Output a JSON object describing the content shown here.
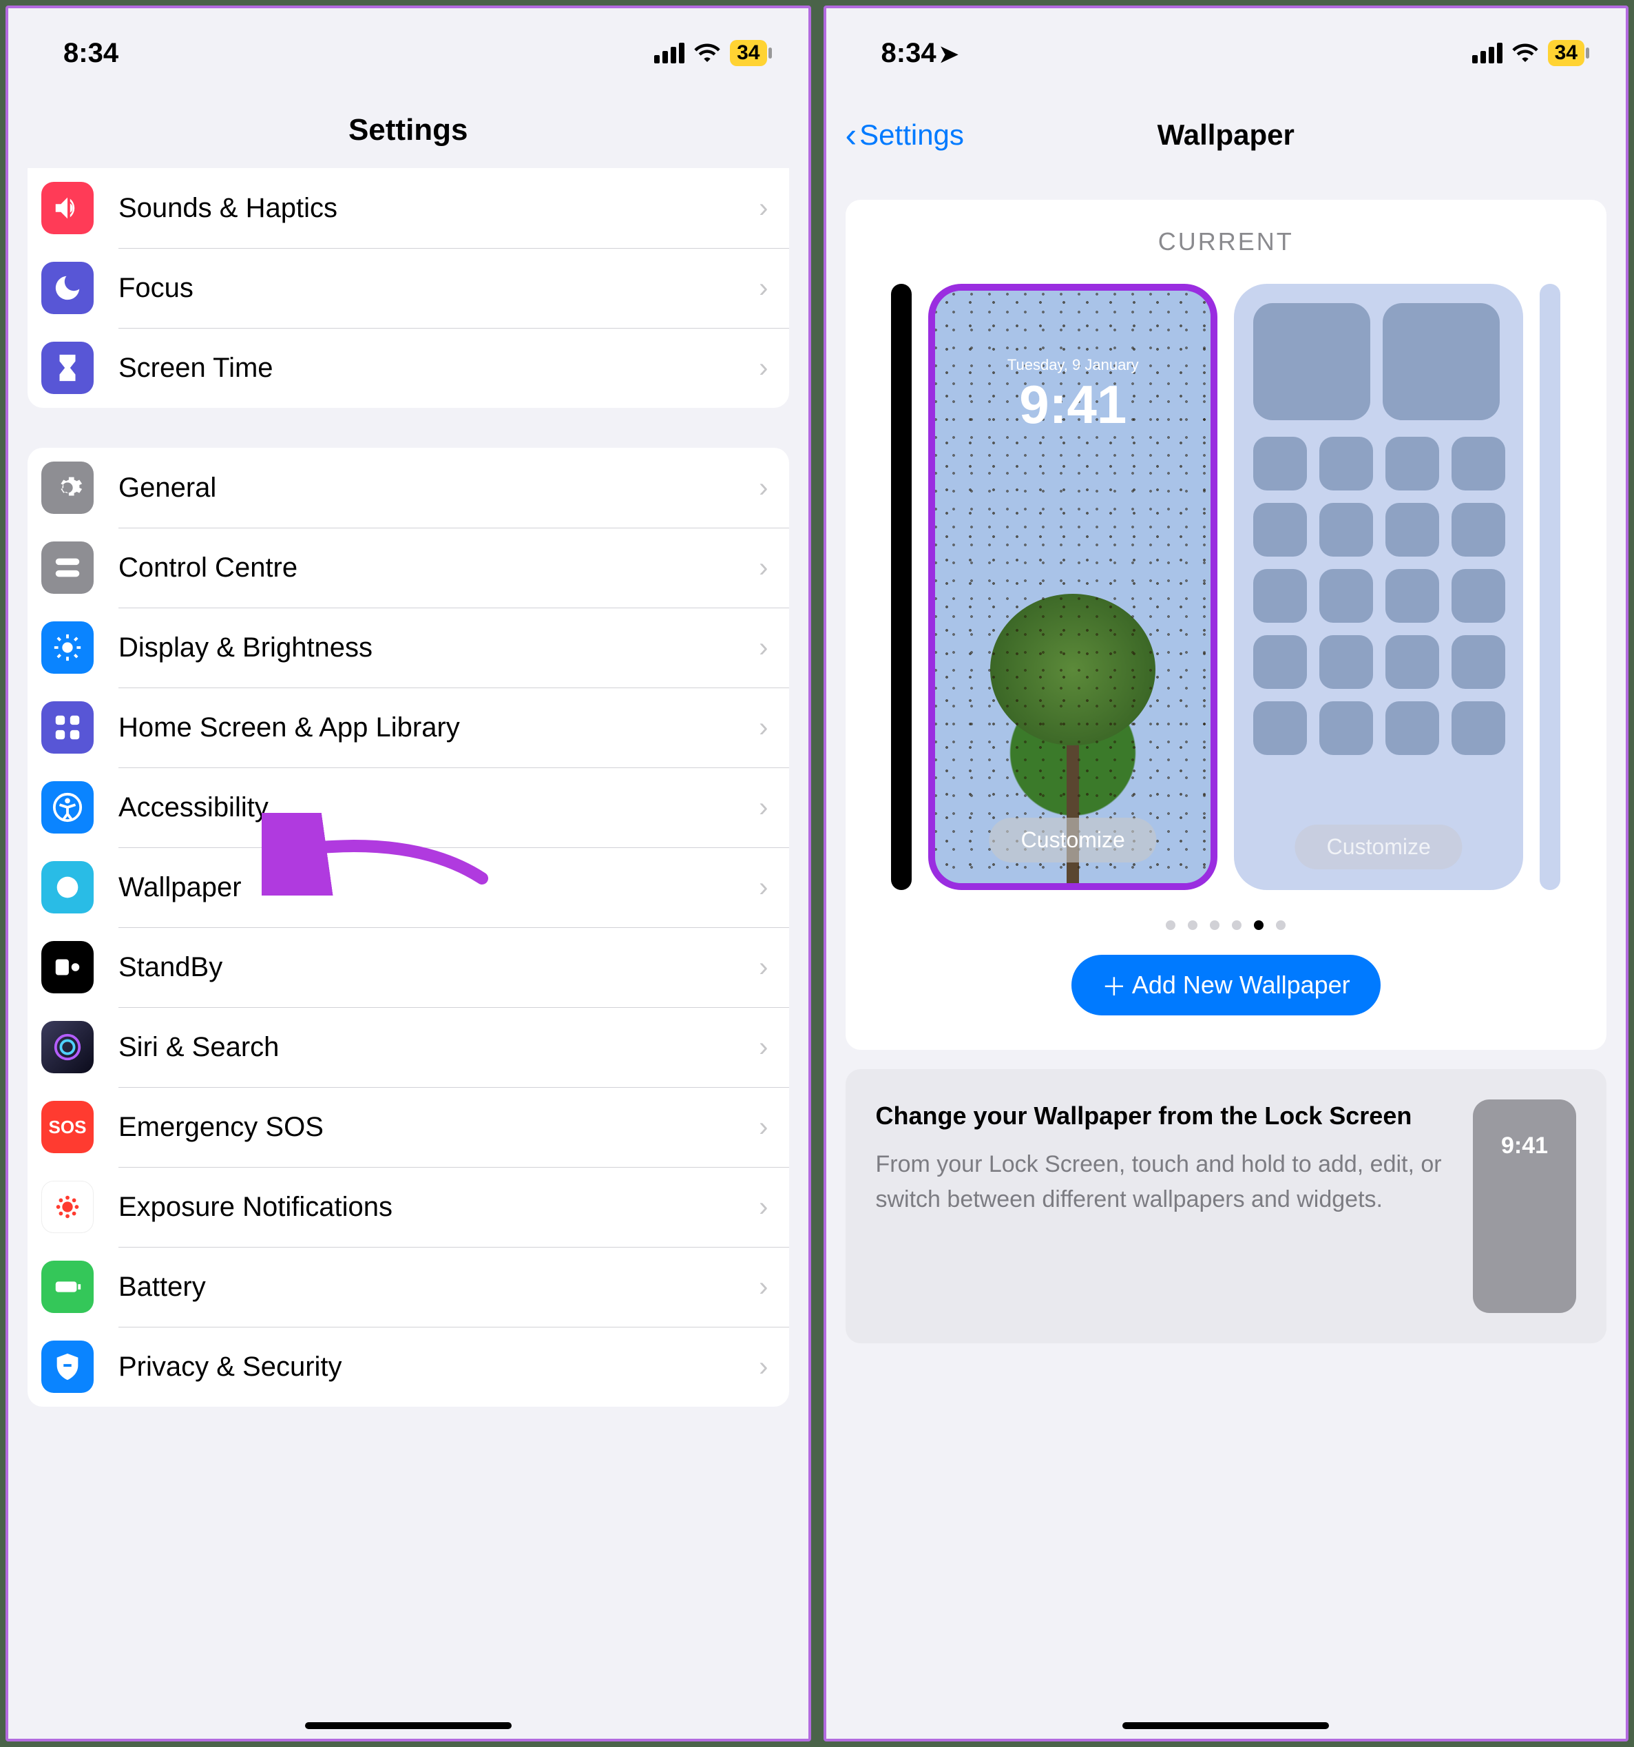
{
  "status": {
    "time": "8:34",
    "battery": "34"
  },
  "left": {
    "title": "Settings",
    "group1": [
      {
        "name": "sounds",
        "label": "Sounds & Haptics"
      },
      {
        "name": "focus",
        "label": "Focus"
      },
      {
        "name": "screentime",
        "label": "Screen Time"
      }
    ],
    "group2": [
      {
        "name": "general",
        "label": "General"
      },
      {
        "name": "control",
        "label": "Control Centre"
      },
      {
        "name": "display",
        "label": "Display & Brightness"
      },
      {
        "name": "home",
        "label": "Home Screen & App Library"
      },
      {
        "name": "access",
        "label": "Accessibility"
      },
      {
        "name": "wallpaper",
        "label": "Wallpaper"
      },
      {
        "name": "standby",
        "label": "StandBy"
      },
      {
        "name": "siri",
        "label": "Siri & Search"
      },
      {
        "name": "sos",
        "label": "Emergency SOS"
      },
      {
        "name": "exposure",
        "label": "Exposure Notifications"
      },
      {
        "name": "battery",
        "label": "Battery"
      },
      {
        "name": "privacy",
        "label": "Privacy & Security"
      }
    ]
  },
  "right": {
    "back": "Settings",
    "title": "Wallpaper",
    "current": "CURRENT",
    "lock_date": "Tuesday, 9 January",
    "lock_time": "9:41",
    "customize": "Customize",
    "add": "Add New Wallpaper",
    "info_title": "Change your Wallpaper from the Lock Screen",
    "info_body": "From your Lock Screen, touch and hold to add, edit, or switch between different wallpapers and widgets.",
    "mini_time": "9:41"
  }
}
